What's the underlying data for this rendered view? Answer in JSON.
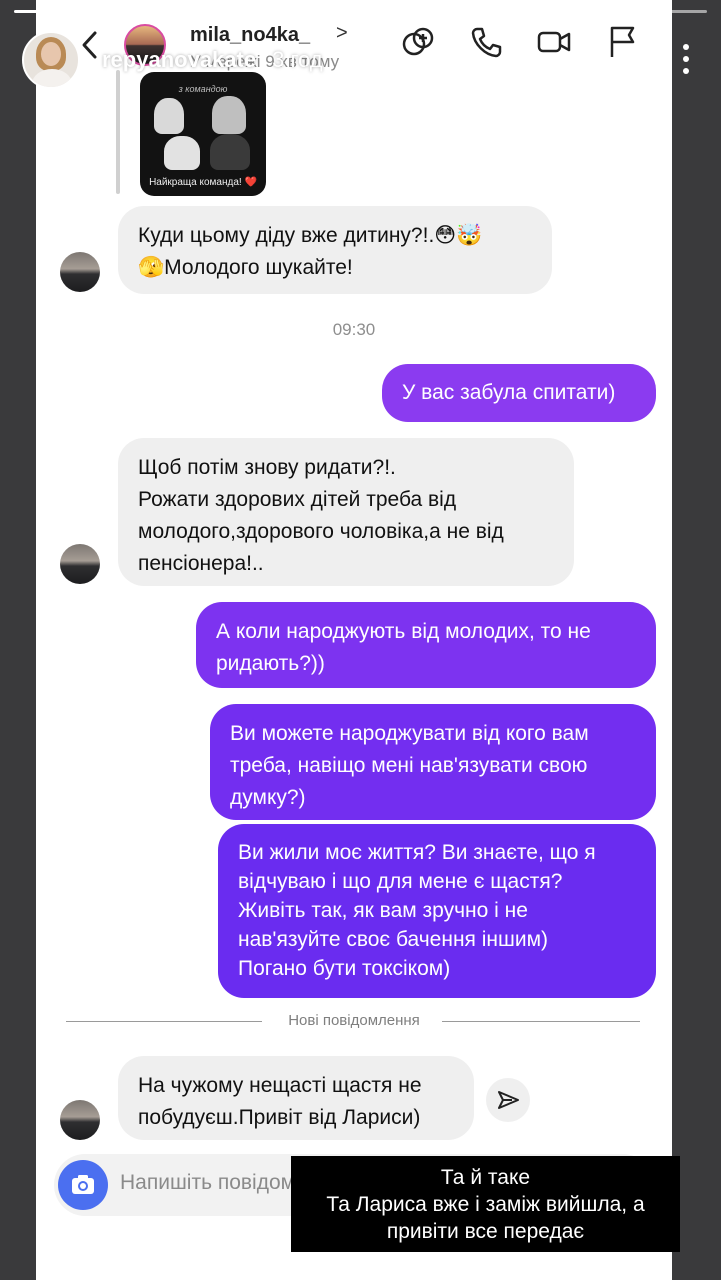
{
  "story": {
    "username": "repyanovakate",
    "time": "3 год",
    "progress_bars_total": 6,
    "progress_bars_viewed": 5
  },
  "chat": {
    "name": "mila_no4ka_",
    "status": "У мережі 9 хв тому",
    "chevron": ">"
  },
  "shared_post": {
    "top_text": "з командою",
    "caption": "Найкраща команда! ❤️"
  },
  "messages": {
    "m1": {
      "line1": "Куди цьому діду вже дитину?!.😳🤯",
      "line2": "🫣Молодого шукайте!"
    },
    "time_label": "09:30",
    "m2": {
      "line1": "У вас забула спитати)"
    },
    "m3": {
      "line1": "Щоб потім знову ридати?!.",
      "line2": "Рожати здорових дітей треба від",
      "line3": "молодого,здорового чоловіка,а не від",
      "line4": "пенсіонера!.."
    },
    "m4": {
      "line1": "А коли народжують від молодих, то не",
      "line2": "ридають?))"
    },
    "m5": {
      "line1": "Ви можете народжувати від кого вам",
      "line2": "треба, навіщо мені нав'язувати свою",
      "line3": "думку?)"
    },
    "m6": {
      "line1": "Ви жили моє життя? Ви знаєте, що я",
      "line2": "відчуваю і що для мене є щастя?",
      "line3": "Живіть так, як вам зручно і не",
      "line4": "нав'язуйте своє бачення іншим)",
      "line5": "Погано бути токсіком)"
    },
    "new_messages_label": "Нові повідомлення",
    "m7": {
      "line1": "На чужому нещасті щастя не",
      "line2": "побудуєш.Привіт від Лариси)"
    }
  },
  "composer": {
    "placeholder": "Напишіть повідомлення..."
  },
  "caption": {
    "line1": "Та й таке",
    "line2": "Та Лариса вже і заміж вийшла, а",
    "line3": "привіти все передає"
  },
  "colors": {
    "outgoing_light": "#8b3bf0",
    "outgoing_dark": "#6a2cf0",
    "incoming": "#efefef",
    "camera": "#4b6ff0",
    "background": "#ffffff"
  },
  "icons": [
    "back-icon",
    "video-effects-icon",
    "phone-icon",
    "video-call-icon",
    "flag-icon",
    "more-icon",
    "share-icon",
    "camera-icon"
  ]
}
